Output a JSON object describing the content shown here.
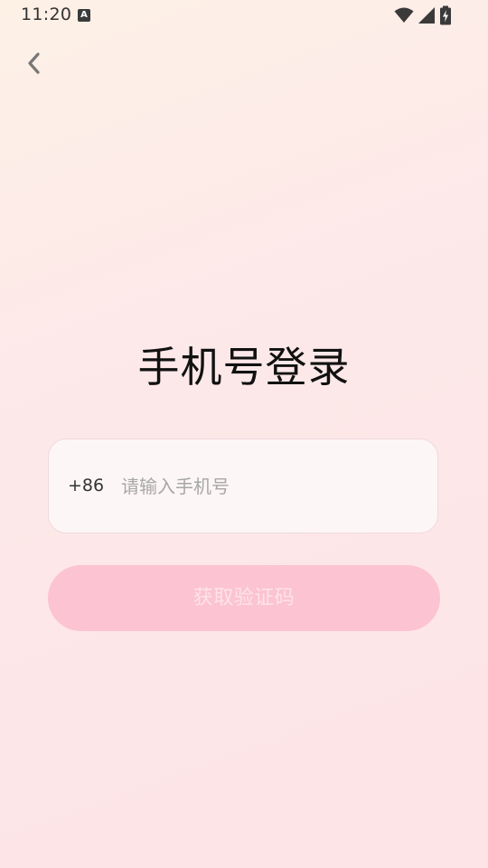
{
  "status_bar": {
    "time": "11:20",
    "notification_icon": "A"
  },
  "header": {
    "back_icon": "chevron-left-icon"
  },
  "main": {
    "title": "手机号登录",
    "phone": {
      "country_code": "+86",
      "placeholder": "请输入手机号",
      "value": ""
    },
    "get_code_label": "获取验证码"
  },
  "colors": {
    "button_bg": "#fcc3d2",
    "button_text": "#fde3ea",
    "card_bg": "#fdf6f6",
    "card_border": "#f0d9dc"
  }
}
